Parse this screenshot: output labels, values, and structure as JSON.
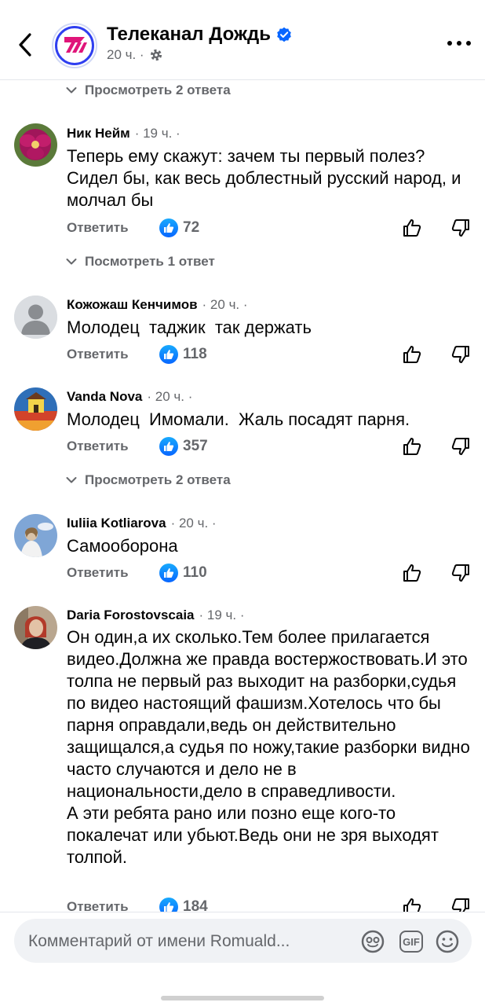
{
  "header": {
    "page_name": "Телеканал Дождь",
    "post_time": "20 ч. ·",
    "icons": {
      "back": "chevron-left-icon",
      "verified": "verified-badge-icon",
      "audience": "gear-icon",
      "more": "more-dots-icon"
    }
  },
  "thread": {
    "view_replies_top": "Просмотреть 2 ответа",
    "comments": [
      {
        "author": "Ник Нейм",
        "time": "· 19 ч. ·",
        "text": "Теперь ему скажут: зачем ты первый полез? Сидел бы, как весь доблестный русский народ, и молчал бы",
        "reply_label": "Ответить",
        "likes": "72",
        "view_replies": "Посмотреть 1 ответ",
        "avatar": "flower-avatar"
      },
      {
        "author": "Кожожаш Кенчимов",
        "time": "· 20 ч. ·",
        "text": "Молодец  таджик  так держать",
        "reply_label": "Ответить",
        "likes": "118",
        "avatar": "default-avatar"
      },
      {
        "author": "Vanda Nova",
        "time": "· 20 ч. ·",
        "text": "Молодец  Имомали.  Жаль посадят парня.",
        "reply_label": "Ответить",
        "likes": "357",
        "view_replies": "Просмотреть 2 ответа",
        "avatar": "painting-avatar"
      },
      {
        "author": "Iuliia Kotliarova",
        "time": "· 20 ч. ·",
        "text": "Самооборона",
        "reply_label": "Ответить",
        "likes": "110",
        "avatar": "sky-avatar"
      },
      {
        "author": "Daria Forostovscaia",
        "time": "· 19 ч. ·",
        "text": "Он один,а их сколько.Тем более прилагается видео.Должна же правда востержоствовать.И это толпа не первый раз выходит на разборки,судья по видео настоящий фашизм.Хотелось что бы парня оправдали,ведь он действительно защищался,а судья по ножу,такие разборки видно часто случаются и дело не в национальности,дело в справедливости.\nА эти ребята рано или позно еще кого-то покалечат или убьют.Ведь они не зря выходят толпой.",
        "reply_label": "Ответить",
        "likes": "184",
        "avatar": "portrait-avatar"
      }
    ]
  },
  "composer": {
    "placeholder": "Комментарий от имени Romuald...",
    "icons": {
      "avatar_sticker": "sticker-icon",
      "gif": "GIF",
      "emoji": "emoji-icon"
    }
  },
  "colors": {
    "accent": "#0866ff",
    "secondary_text": "#65676b",
    "background": "#ffffff",
    "input_background": "#f0f2f5"
  }
}
